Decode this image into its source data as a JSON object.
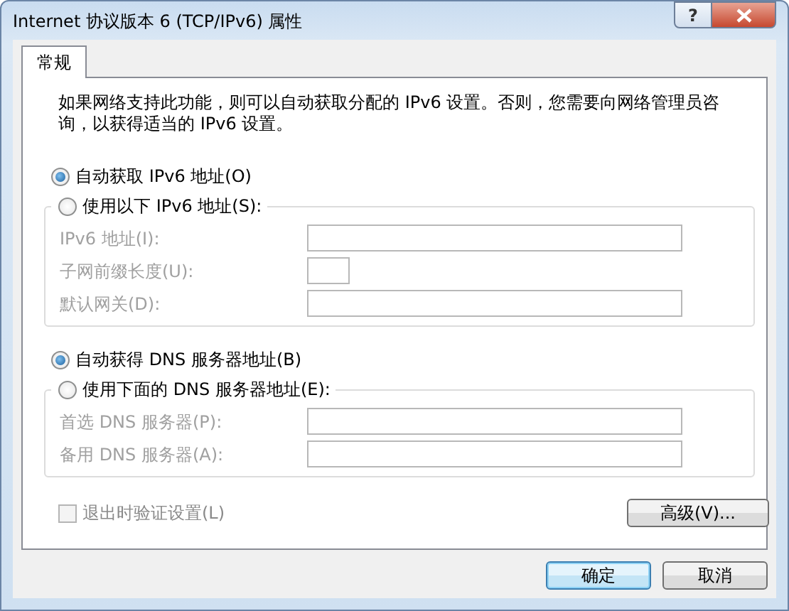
{
  "window": {
    "title": "Internet 协议版本 6 (TCP/IPv6) 属性",
    "help_button": "?"
  },
  "tabs": [
    {
      "label": "常规",
      "selected": true
    }
  ],
  "description": "如果网络支持此功能，则可以自动获取分配的 IPv6 设置。否则，您需要向网络管理员咨询，以获得适当的 IPv6 设置。",
  "sections": [
    {
      "options": [
        {
          "label": "自动获取 IPv6 地址(O)",
          "selected": true
        },
        {
          "label": "使用以下 IPv6 地址(S):",
          "selected": false
        }
      ],
      "fields": [
        {
          "label": "IPv6 地址(I):",
          "kind": "wide",
          "disabled": true
        },
        {
          "label": "子网前缀长度(U):",
          "kind": "short",
          "disabled": true
        },
        {
          "label": "默认网关(D):",
          "kind": "wide",
          "disabled": true
        }
      ]
    },
    {
      "options": [
        {
          "label": "自动获得 DNS 服务器地址(B)",
          "selected": true
        },
        {
          "label": "使用下面的 DNS 服务器地址(E):",
          "selected": false
        }
      ],
      "fields": [
        {
          "label": "首选 DNS 服务器(P):",
          "kind": "wide",
          "disabled": true
        },
        {
          "label": "备用 DNS 服务器(A):",
          "kind": "wide",
          "disabled": true
        }
      ]
    }
  ],
  "validate_checkbox": {
    "label": "退出时验证设置(L)",
    "checked": false,
    "disabled": true
  },
  "advanced_button": "高级(V)...",
  "buttons": [
    {
      "label": "确定",
      "default": true
    },
    {
      "label": "取消",
      "default": false
    }
  ]
}
